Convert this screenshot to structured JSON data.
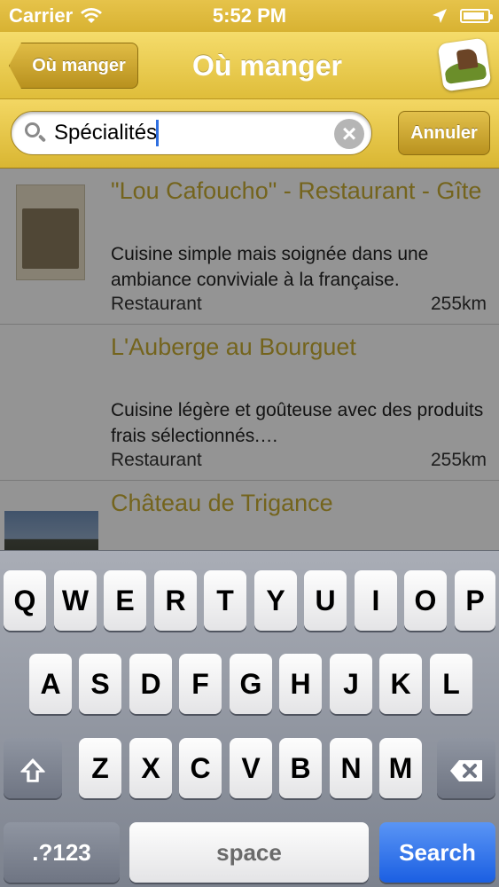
{
  "status_bar": {
    "carrier": "Carrier",
    "time": "5:52 PM",
    "battery_level": 0.9
  },
  "nav": {
    "back_label": "Où manger",
    "title": "Où manger"
  },
  "search": {
    "value": "Spécialités",
    "clear_symbol": "×",
    "cancel_label": "Annuler"
  },
  "results": [
    {
      "title": "\"Lou Cafoucho\" - Restaurant - Gîte",
      "description": "Cuisine simple mais soignée dans une ambiance conviviale à la française.",
      "category": "Restaurant",
      "distance": "255km"
    },
    {
      "title": "L'Auberge au Bourguet",
      "description": "Cuisine légère et goûteuse avec des produits frais sélectionnés.…",
      "category": "Restaurant",
      "distance": "255km"
    },
    {
      "title": "Château de Trigance",
      "description": "",
      "category": "",
      "distance": ""
    }
  ],
  "keyboard": {
    "row1": [
      "Q",
      "W",
      "E",
      "R",
      "T",
      "Y",
      "U",
      "I",
      "O",
      "P"
    ],
    "row2": [
      "A",
      "S",
      "D",
      "F",
      "G",
      "H",
      "J",
      "K",
      "L"
    ],
    "row3": [
      "Z",
      "X",
      "C",
      "V",
      "B",
      "N",
      "M"
    ],
    "numbers_label": ".?123",
    "space_label": "space",
    "search_label": "Search"
  },
  "colors": {
    "brand_gold": "#dfbd3a",
    "title_gold": "#c8ad33",
    "search_blue": "#1b5fe2"
  },
  "icons": [
    "wifi-icon",
    "location-arrow-icon",
    "battery-icon",
    "search-icon",
    "clear-icon",
    "shift-icon",
    "backspace-icon",
    "app-logo"
  ]
}
